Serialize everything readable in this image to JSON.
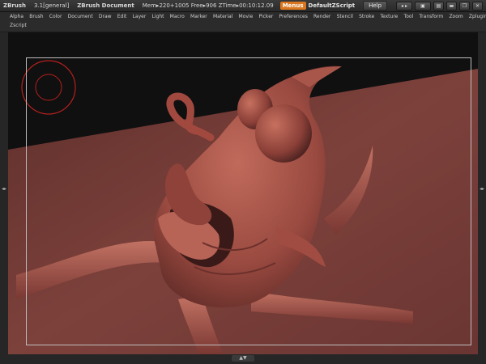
{
  "titlebar": {
    "app": "ZBrush",
    "version": "3.1[general]",
    "document": "ZBrush Document",
    "mem": "Mem▸220+1005 Free▸906 ZTime▸00:10:12.09",
    "menus_label": "Menus",
    "script": "DefaultZScript",
    "help_label": "Help"
  },
  "menubar": {
    "items": [
      "Alpha",
      "Brush",
      "Color",
      "Document",
      "Draw",
      "Edit",
      "Layer",
      "Light",
      "Macro",
      "Marker",
      "Material",
      "Movie",
      "Picker",
      "Preferences",
      "Render",
      "Stencil",
      "Stroke",
      "Texture",
      "Tool",
      "Transform",
      "Zoom",
      "Zplugin"
    ],
    "second_row": "Zscript"
  },
  "colors": {
    "model": "#9e4a40",
    "floor": "#7a3f3a",
    "accent": "#d9761f"
  }
}
